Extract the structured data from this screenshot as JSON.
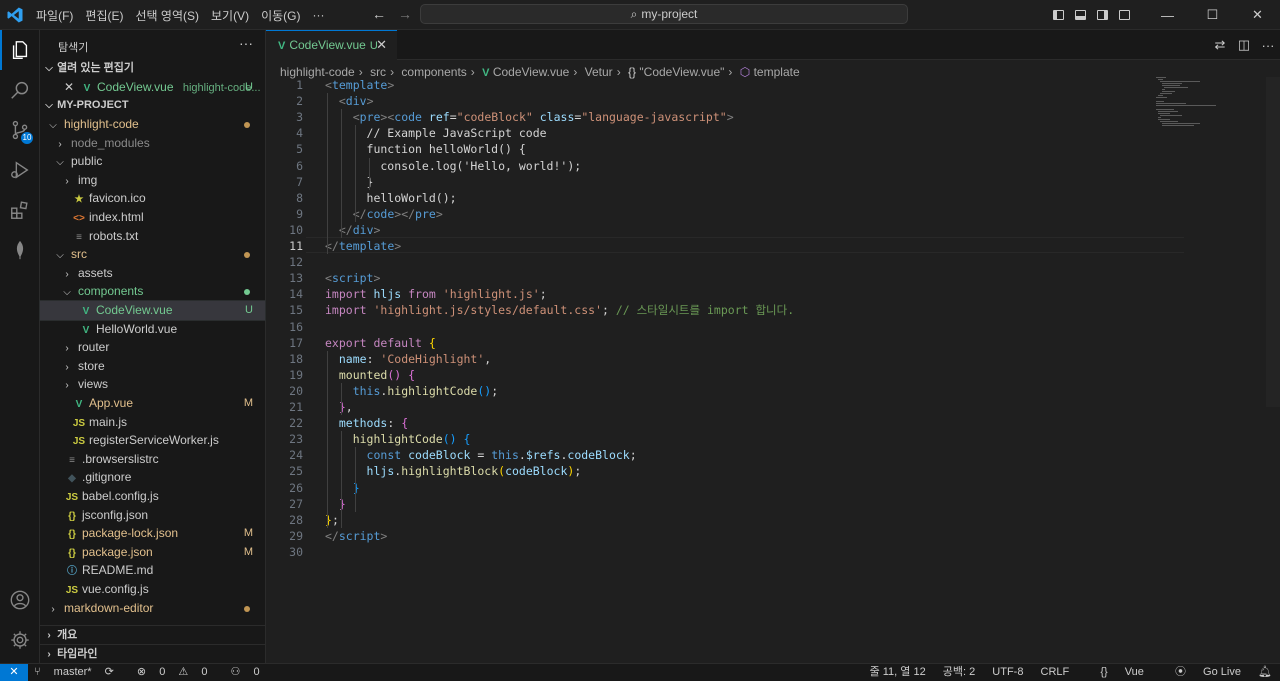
{
  "menu": [
    "파일(F)",
    "편집(E)",
    "선택 영역(S)",
    "보기(V)",
    "이동(G)",
    "···"
  ],
  "search": {
    "text": "my-project"
  },
  "sidebar": {
    "title": "탐색기",
    "more": "···",
    "open_editors": {
      "header": "열려 있는 편집기",
      "file": "CodeView.vue",
      "path": "highlight-code...",
      "status": "U"
    },
    "project": "MY-PROJECT",
    "tree": [
      {
        "label": "highlight-code",
        "indent": 1,
        "kind": "folder-open",
        "color": "orange",
        "dot": "#c09553"
      },
      {
        "label": "node_modules",
        "indent": 2,
        "kind": "folder",
        "color": "gray"
      },
      {
        "label": "public",
        "indent": 2,
        "kind": "folder-open",
        "color": "default"
      },
      {
        "label": "img",
        "indent": 3,
        "kind": "folder",
        "color": "default"
      },
      {
        "label": "favicon.ico",
        "indent": 3,
        "kind": "star",
        "color": "default"
      },
      {
        "label": "index.html",
        "indent": 3,
        "kind": "html",
        "color": "default"
      },
      {
        "label": "robots.txt",
        "indent": 3,
        "kind": "txt",
        "color": "default"
      },
      {
        "label": "src",
        "indent": 2,
        "kind": "folder-open",
        "color": "orange",
        "dot": "#c09553"
      },
      {
        "label": "assets",
        "indent": 3,
        "kind": "folder",
        "color": "default"
      },
      {
        "label": "components",
        "indent": 3,
        "kind": "folder-open",
        "color": "green",
        "dot": "#73c991"
      },
      {
        "label": "CodeView.vue",
        "indent": 4,
        "kind": "vue",
        "color": "green",
        "status": "U",
        "selected": true
      },
      {
        "label": "HelloWorld.vue",
        "indent": 4,
        "kind": "vue",
        "color": "default"
      },
      {
        "label": "router",
        "indent": 3,
        "kind": "folder",
        "color": "default"
      },
      {
        "label": "store",
        "indent": 3,
        "kind": "folder",
        "color": "default"
      },
      {
        "label": "views",
        "indent": 3,
        "kind": "folder",
        "color": "default"
      },
      {
        "label": "App.vue",
        "indent": 3,
        "kind": "vue",
        "color": "orange",
        "status": "M"
      },
      {
        "label": "main.js",
        "indent": 3,
        "kind": "js",
        "color": "default"
      },
      {
        "label": "registerServiceWorker.js",
        "indent": 3,
        "kind": "js",
        "color": "default"
      },
      {
        "label": ".browserslistrc",
        "indent": 2,
        "kind": "txt",
        "color": "default"
      },
      {
        "label": ".gitignore",
        "indent": 2,
        "kind": "git",
        "color": "default"
      },
      {
        "label": "babel.config.js",
        "indent": 2,
        "kind": "js",
        "color": "default"
      },
      {
        "label": "jsconfig.json",
        "indent": 2,
        "kind": "json",
        "color": "default"
      },
      {
        "label": "package-lock.json",
        "indent": 2,
        "kind": "json",
        "color": "orange",
        "status": "M"
      },
      {
        "label": "package.json",
        "indent": 2,
        "kind": "json",
        "color": "orange",
        "status": "M"
      },
      {
        "label": "README.md",
        "indent": 2,
        "kind": "info",
        "color": "default"
      },
      {
        "label": "vue.config.js",
        "indent": 2,
        "kind": "js",
        "color": "default"
      },
      {
        "label": "markdown-editor",
        "indent": 1,
        "kind": "folder",
        "color": "orange",
        "dot": "#c09553"
      }
    ],
    "outline": "개요",
    "timeline": "타임라인"
  },
  "activity": {
    "scm_badge": "10"
  },
  "tab": {
    "label": "CodeView.vue",
    "status": "U",
    "close": "✕"
  },
  "breadcrumb": [
    "highlight-code",
    "src",
    "components",
    "CodeView.vue",
    "Vetur",
    "\"CodeView.vue\"",
    "template"
  ],
  "code": [
    [
      [
        "t-tag",
        "<"
      ],
      [
        "t-el",
        "template"
      ],
      [
        "t-tag",
        ">"
      ]
    ],
    [
      [
        "t-tx",
        "  "
      ],
      [
        "t-tag",
        "<"
      ],
      [
        "t-el",
        "div"
      ],
      [
        "t-tag",
        ">"
      ]
    ],
    [
      [
        "t-tx",
        "    "
      ],
      [
        "t-tag",
        "<"
      ],
      [
        "t-el",
        "pre"
      ],
      [
        "t-tag",
        "><"
      ],
      [
        "t-el",
        "code"
      ],
      [
        "t-tx",
        " "
      ],
      [
        "t-at",
        "ref"
      ],
      [
        "t-tx",
        "="
      ],
      [
        "t-str",
        "\"codeBlock\""
      ],
      [
        "t-tx",
        " "
      ],
      [
        "t-at",
        "class"
      ],
      [
        "t-tx",
        "="
      ],
      [
        "t-str",
        "\"language-javascript\""
      ],
      [
        "t-tag",
        ">"
      ]
    ],
    [
      [
        "t-tx",
        "      // Example JavaScript code"
      ]
    ],
    [
      [
        "t-tx",
        "      function helloWorld() {"
      ]
    ],
    [
      [
        "t-tx",
        "        console.log('Hello, world!');"
      ]
    ],
    [
      [
        "t-tx",
        "      }"
      ]
    ],
    [
      [
        "t-tx",
        "      helloWorld();"
      ]
    ],
    [
      [
        "t-tx",
        "    "
      ],
      [
        "t-tag",
        "</"
      ],
      [
        "t-el",
        "code"
      ],
      [
        "t-tag",
        "></"
      ],
      [
        "t-el",
        "pre"
      ],
      [
        "t-tag",
        ">"
      ]
    ],
    [
      [
        "t-tx",
        "  "
      ],
      [
        "t-tag",
        "</"
      ],
      [
        "t-el",
        "div"
      ],
      [
        "t-tag",
        ">"
      ]
    ],
    [
      [
        "t-tag",
        "</"
      ],
      [
        "t-el",
        "template"
      ],
      [
        "t-tag",
        ">"
      ]
    ],
    [],
    [
      [
        "t-tag",
        "<"
      ],
      [
        "t-el",
        "script"
      ],
      [
        "t-tag",
        ">"
      ]
    ],
    [
      [
        "t-kw",
        "import"
      ],
      [
        "t-tx",
        " "
      ],
      [
        "t-var",
        "hljs"
      ],
      [
        "t-tx",
        " "
      ],
      [
        "t-kw",
        "from"
      ],
      [
        "t-tx",
        " "
      ],
      [
        "t-str",
        "'highlight.js'"
      ],
      [
        "t-tx",
        ";"
      ]
    ],
    [
      [
        "t-kw",
        "import"
      ],
      [
        "t-tx",
        " "
      ],
      [
        "t-str",
        "'highlight.js/styles/default.css'"
      ],
      [
        "t-tx",
        "; "
      ],
      [
        "t-cm",
        "// 스타일시트를 import 합니다."
      ]
    ],
    [],
    [
      [
        "t-kw",
        "export"
      ],
      [
        "t-tx",
        " "
      ],
      [
        "t-kw",
        "default"
      ],
      [
        "t-tx",
        " "
      ],
      [
        "t-b1",
        "{"
      ]
    ],
    [
      [
        "t-tx",
        "  "
      ],
      [
        "t-var",
        "name"
      ],
      [
        "t-tx",
        ": "
      ],
      [
        "t-str",
        "'CodeHighlight'"
      ],
      [
        "t-tx",
        ","
      ]
    ],
    [
      [
        "t-tx",
        "  "
      ],
      [
        "t-fn",
        "mounted"
      ],
      [
        "t-b2",
        "()"
      ],
      [
        "t-tx",
        " "
      ],
      [
        "t-b2",
        "{"
      ]
    ],
    [
      [
        "t-tx",
        "    "
      ],
      [
        "t-this",
        "this"
      ],
      [
        "t-tx",
        "."
      ],
      [
        "t-fn",
        "highlightCode"
      ],
      [
        "t-b3",
        "()"
      ],
      [
        "t-tx",
        ";"
      ]
    ],
    [
      [
        "t-tx",
        "  "
      ],
      [
        "t-b2",
        "}"
      ],
      [
        "t-tx",
        ","
      ]
    ],
    [
      [
        "t-tx",
        "  "
      ],
      [
        "t-var",
        "methods"
      ],
      [
        "t-tx",
        ": "
      ],
      [
        "t-b2",
        "{"
      ]
    ],
    [
      [
        "t-tx",
        "    "
      ],
      [
        "t-fn",
        "highlightCode"
      ],
      [
        "t-b3",
        "()"
      ],
      [
        "t-tx",
        " "
      ],
      [
        "t-b3",
        "{"
      ]
    ],
    [
      [
        "t-tx",
        "      "
      ],
      [
        "t-this",
        "const"
      ],
      [
        "t-tx",
        " "
      ],
      [
        "t-var",
        "codeBlock"
      ],
      [
        "t-tx",
        " = "
      ],
      [
        "t-this",
        "this"
      ],
      [
        "t-tx",
        "."
      ],
      [
        "t-var",
        "$refs"
      ],
      [
        "t-tx",
        "."
      ],
      [
        "t-var",
        "codeBlock"
      ],
      [
        "t-tx",
        ";"
      ]
    ],
    [
      [
        "t-tx",
        "      "
      ],
      [
        "t-var",
        "hljs"
      ],
      [
        "t-tx",
        "."
      ],
      [
        "t-fn",
        "highlightBlock"
      ],
      [
        "t-b1",
        "("
      ],
      [
        "t-var",
        "codeBlock"
      ],
      [
        "t-b1",
        ")"
      ],
      [
        "t-tx",
        ";"
      ]
    ],
    [
      [
        "t-tx",
        "    "
      ],
      [
        "t-b3",
        "}"
      ]
    ],
    [
      [
        "t-tx",
        "  "
      ],
      [
        "t-b2",
        "}"
      ]
    ],
    [
      [
        "t-b1",
        "}"
      ],
      [
        "t-tx",
        ";"
      ]
    ],
    [
      [
        "t-tag",
        "</"
      ],
      [
        "t-el",
        "script"
      ],
      [
        "t-tag",
        ">"
      ]
    ],
    []
  ],
  "current_line": 11,
  "status": {
    "remote": "✕",
    "branch": "master*",
    "errors": "0",
    "warnings": "0",
    "ports": "0",
    "position": "줄 11, 열 12",
    "spaces": "공백: 2",
    "encoding": "UTF-8",
    "eol": "CRLF",
    "language": "Vue",
    "golive": "Go Live"
  }
}
